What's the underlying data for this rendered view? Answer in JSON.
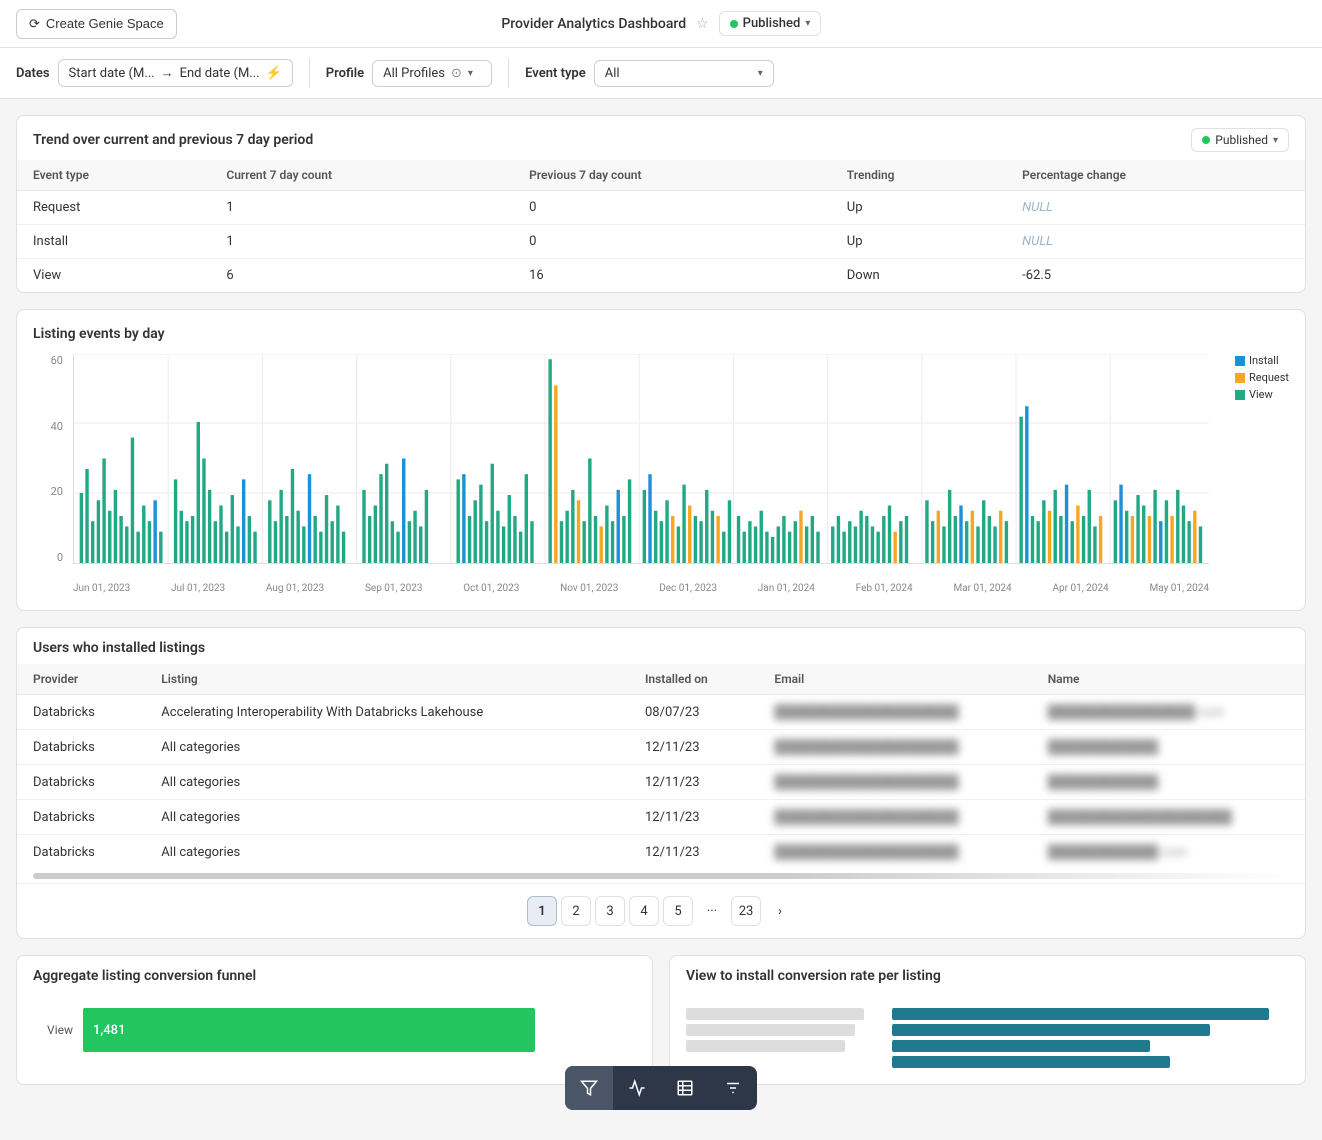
{
  "header": {
    "create_btn": "Create Genie Space",
    "dashboard_title": "Provider Analytics Dashboard",
    "published_label": "Published"
  },
  "filters": {
    "dates_label": "Dates",
    "start_placeholder": "Start date (M...",
    "arrow": "→",
    "end_placeholder": "End date (M...",
    "profile_label": "Profile",
    "all_profiles": "All Profiles",
    "event_type_label": "Event type",
    "event_type_value": "All"
  },
  "trend_section": {
    "title": "Trend over current and previous 7 day period",
    "published_label": "Published",
    "columns": [
      "Event type",
      "Current 7 day count",
      "Previous 7 day count",
      "Trending",
      "Percentage change"
    ],
    "rows": [
      {
        "event_type": "Request",
        "current": "1",
        "previous": "0",
        "trending": "Up",
        "pct_change": "NULL",
        "null": true
      },
      {
        "event_type": "Install",
        "current": "1",
        "previous": "0",
        "trending": "Up",
        "pct_change": "NULL",
        "null": true
      },
      {
        "event_type": "View",
        "current": "6",
        "previous": "16",
        "trending": "Down",
        "pct_change": "-62.5",
        "null": false
      }
    ]
  },
  "chart_section": {
    "title": "Listing events by day",
    "y_labels": [
      "60",
      "40",
      "20",
      "0"
    ],
    "x_labels": [
      "Jun 01, 2023",
      "Jul 01, 2023",
      "Aug 01, 2023",
      "Sep 01, 2023",
      "Oct 01, 2023",
      "Nov 01, 2023",
      "Dec 01, 2023",
      "Jan 01, 2024",
      "Feb 01, 2024",
      "Mar 01, 2024",
      "Apr 01, 2024",
      "May 01, 2024"
    ],
    "legend": [
      {
        "label": "Install",
        "color": "#1e90d4"
      },
      {
        "label": "Request",
        "color": "#f5a623"
      },
      {
        "label": "View",
        "color": "#22a884"
      }
    ]
  },
  "users_section": {
    "title": "Users who installed listings",
    "columns": [
      "Provider",
      "Listing",
      "Installed on",
      "Email",
      "Name"
    ],
    "rows": [
      {
        "provider": "Databricks",
        "listing": "Accelerating Interoperability With Databricks Lakehouse",
        "installed_on": "08/07/23",
        "email": "████████████████████",
        "name": "████████████████ com"
      },
      {
        "provider": "Databricks",
        "listing": "All categories",
        "installed_on": "12/11/23",
        "email": "████████████████████",
        "name": "████████████"
      },
      {
        "provider": "Databricks",
        "listing": "All categories",
        "installed_on": "12/11/23",
        "email": "████████████████████",
        "name": "████████████"
      },
      {
        "provider": "Databricks",
        "listing": "All categories",
        "installed_on": "12/11/23",
        "email": "████████████████████",
        "name": "████████████████████"
      },
      {
        "provider": "Databricks",
        "listing": "All categories",
        "installed_on": "12/11/23",
        "email": "████████████████████",
        "name": "████████████ com"
      }
    ]
  },
  "pagination": {
    "pages": [
      "1",
      "2",
      "3",
      "4",
      "5",
      "...",
      "23"
    ],
    "active": "1"
  },
  "funnel_section": {
    "title": "Aggregate listing conversion funnel",
    "rows": [
      {
        "label": "View",
        "value": "1,481",
        "width_pct": 80
      }
    ]
  },
  "conversion_section": {
    "title": "View to install conversion rate per listing"
  },
  "toolbar": {
    "buttons": [
      "filter",
      "chart-line",
      "table",
      "filter-alt"
    ]
  }
}
